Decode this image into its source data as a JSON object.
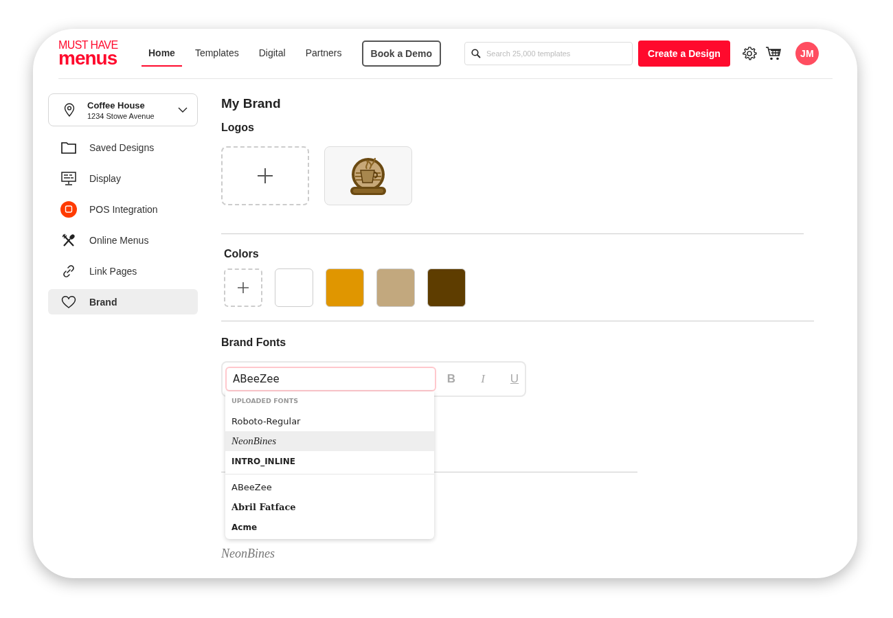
{
  "logo": {
    "top": "MUST HAVE",
    "bottom": "menus"
  },
  "nav": [
    {
      "label": "Home",
      "selected": true
    },
    {
      "label": "Templates",
      "selected": false
    },
    {
      "label": "Digital",
      "selected": false
    },
    {
      "label": "Partners",
      "selected": false
    }
  ],
  "demo_button": "Book a Demo",
  "search": {
    "placeholder": "Search 25,000 templates"
  },
  "create_button": "Create a Design",
  "avatar": "JM",
  "location": {
    "name": "Coffee House",
    "address": "1234 Stowe Avenue"
  },
  "sidebar": {
    "items": [
      {
        "label": "Saved Designs",
        "kind": "folder",
        "selected": false
      },
      {
        "label": "Display",
        "kind": "display",
        "selected": false
      },
      {
        "label": "POS Integration",
        "kind": "pos",
        "selected": false
      },
      {
        "label": "Online Menus",
        "kind": "utensils",
        "selected": false
      },
      {
        "label": "Link Pages",
        "kind": "link",
        "selected": false
      },
      {
        "label": "Brand",
        "kind": "heart",
        "selected": true
      }
    ]
  },
  "title": "My Brand",
  "logos": {
    "heading": "Logos",
    "items": [
      {
        "kind": "add"
      },
      {
        "kind": "logo"
      }
    ]
  },
  "colors": {
    "heading": "Colors",
    "swatches": [
      {
        "color": "#ffffff"
      },
      {
        "color": "#e09600"
      },
      {
        "color": "#c2a87e"
      },
      {
        "color": "#5e3d00"
      }
    ]
  },
  "brand_fonts": {
    "heading": "Brand Fonts",
    "font_field": "ABeeZee",
    "dropdown": {
      "group_label": "UPLOADED FONTS",
      "uploaded": [
        {
          "label": "Roboto-Regular",
          "kind": "sans",
          "selected": false
        },
        {
          "label": "NeonBines",
          "kind": "script",
          "selected": true
        },
        {
          "label": "INTRO_INLINE",
          "kind": "display",
          "selected": false
        }
      ],
      "fonts": [
        {
          "label": "ABeeZee",
          "kind": "sans",
          "selected": false
        },
        {
          "label": "Abril Fatface",
          "kind": "serif",
          "selected": false
        },
        {
          "label": "Acme",
          "kind": "display",
          "selected": false
        }
      ]
    },
    "format_buttons": [
      {
        "label": "B",
        "kind": "bold"
      },
      {
        "label": "I",
        "kind": "italic"
      },
      {
        "label": "U",
        "kind": "underline"
      }
    ],
    "behind": [
      {
        "kind": "rule"
      },
      {
        "text": "NeonBines",
        "kind": "script"
      }
    ]
  }
}
